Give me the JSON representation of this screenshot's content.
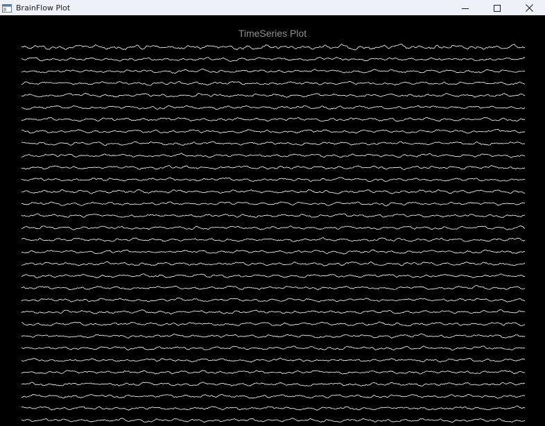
{
  "window": {
    "title": "BrainFlow Plot",
    "icons": {
      "app": "app-window-icon",
      "minimize": "minimize-icon",
      "maximize": "maximize-icon",
      "close": "close-icon"
    }
  },
  "colors": {
    "background": "#000000",
    "trace": "#ffffff",
    "title_text": "#8f8f8f",
    "titlebar": "#eef2f8"
  },
  "chart_data": {
    "type": "line",
    "title": "TimeSeries Plot",
    "xlabel": "",
    "ylabel": "",
    "grid": false,
    "legend": "none",
    "layout": "stacked-channels",
    "channel_count": 32
  }
}
